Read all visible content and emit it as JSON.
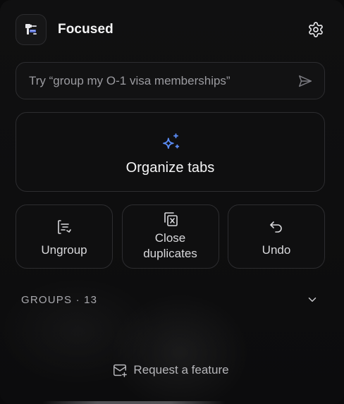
{
  "header": {
    "title": "Focused",
    "logo_icon": "plug-tab-icon",
    "settings_icon": "gear-icon"
  },
  "prompt": {
    "placeholder": "Try “group my O-1 visa memberships”",
    "value": "",
    "send_icon": "send-icon"
  },
  "organize": {
    "label": "Organize tabs",
    "icon": "sparkles-icon",
    "accent": "#5b8cf5"
  },
  "actions": [
    {
      "label": "Ungroup",
      "icon": "ungroup-icon"
    },
    {
      "label": "Close duplicates",
      "line1": "Close",
      "line2": "duplicates",
      "icon": "close-duplicates-icon"
    },
    {
      "label": "Undo",
      "icon": "undo-icon"
    }
  ],
  "groups": {
    "label": "GROUPS · 13",
    "count": 13,
    "chevron_icon": "chevron-down-icon"
  },
  "footer": {
    "request_label": "Request a feature",
    "icon": "mail-plus-icon"
  }
}
